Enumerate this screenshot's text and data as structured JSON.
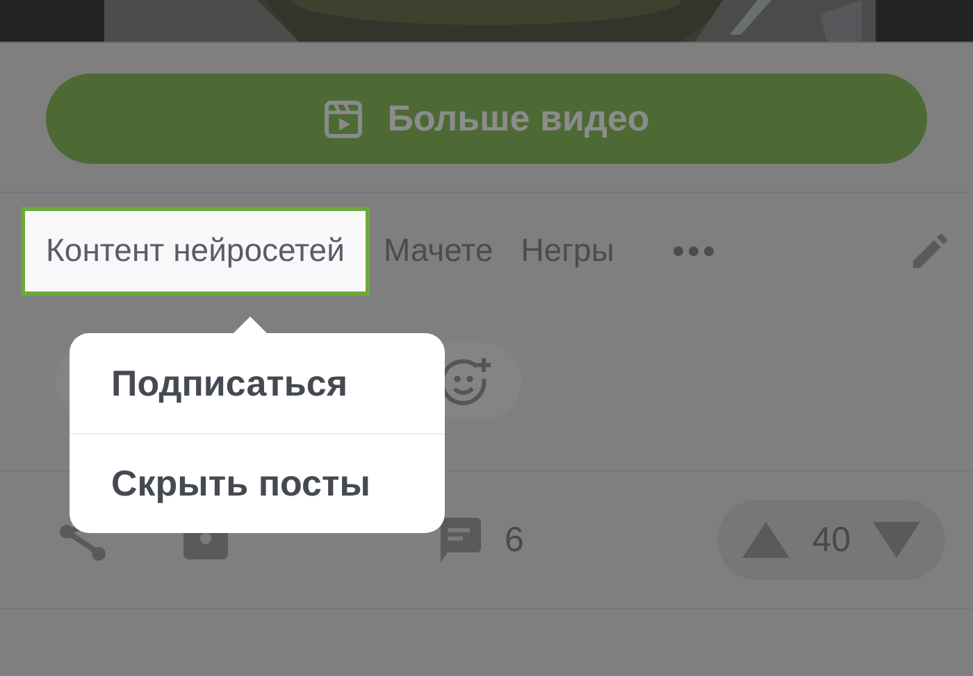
{
  "more_button": {
    "label": "Больше видео"
  },
  "tags": [
    {
      "label": "Контент нейросетей",
      "selected": true
    },
    {
      "label": "Мачете",
      "selected": false
    },
    {
      "label": "Негры",
      "selected": false
    }
  ],
  "menu": {
    "items": [
      "Подписаться",
      "Скрыть посты"
    ]
  },
  "actions": {
    "comments": "6",
    "score": "40"
  }
}
